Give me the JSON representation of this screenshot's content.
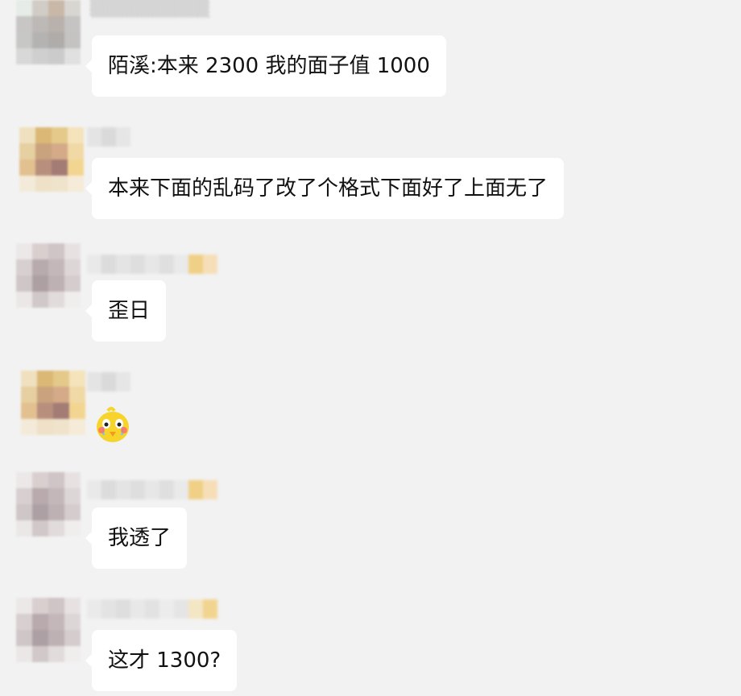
{
  "chat": {
    "messages": [
      {
        "text": "陌溪:本来 2300 我的面子值 1000",
        "type": "text"
      },
      {
        "text": "本来下面的乱码了改了个格式下面好了上面无了",
        "type": "text"
      },
      {
        "text": "歪日",
        "type": "text"
      },
      {
        "text": "",
        "type": "sticker",
        "sticker": "yellow-duck-crying-sticker"
      },
      {
        "text": "我透了",
        "type": "text"
      },
      {
        "text": "这才 1300?",
        "type": "text"
      }
    ]
  },
  "colors": {
    "background": "#f2f2f2",
    "bubble": "#ffffff",
    "text": "#111111"
  }
}
